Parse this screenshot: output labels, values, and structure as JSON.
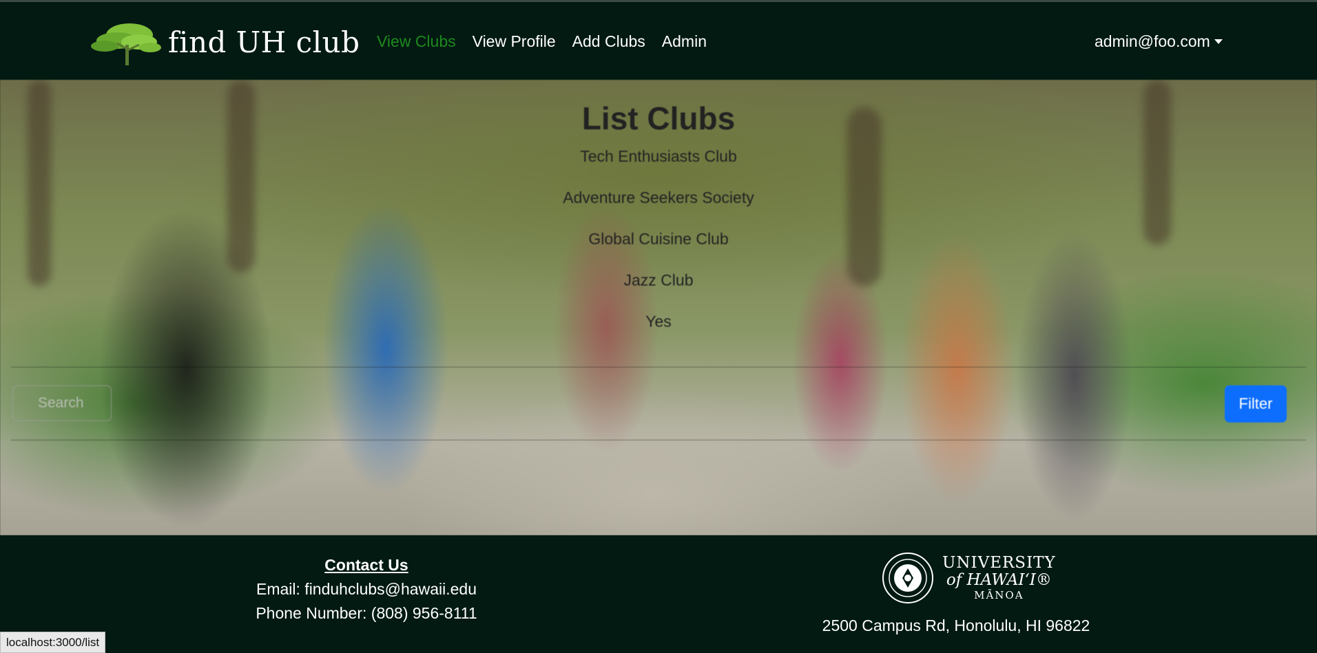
{
  "navbar": {
    "brand_text": "find UH club",
    "links": [
      {
        "label": "View Clubs",
        "active": true
      },
      {
        "label": "View Profile",
        "active": false
      },
      {
        "label": "Add Clubs",
        "active": false
      },
      {
        "label": "Admin",
        "active": false
      }
    ],
    "user_menu_label": "admin@foo.com",
    "icons": {
      "brand_logo": "tree-logo-icon",
      "user_menu": "caret-down-icon"
    },
    "colors": {
      "background": "#021a12",
      "active_link": "#1e8a1e"
    }
  },
  "main": {
    "title": "List Clubs",
    "clubs": [
      "Tech Enthusiasts Club",
      "Adventure Seekers Society",
      "Global Cuisine Club",
      "Jazz Club",
      "Yes"
    ],
    "search_placeholder": "Search",
    "filter_label": "Filter",
    "colors": {
      "filter_button": "#0d6efd"
    }
  },
  "footer": {
    "contact_title": "Contact Us",
    "email_line": "Email: finduhclubs@hawaii.edu",
    "phone_line": "Phone Number: (808) 956-8111",
    "uh_logo": {
      "line1": "UNIVERSITY",
      "line2": "of HAWAI‘I®",
      "line3": "MĀNOA"
    },
    "address": "2500 Campus Rd, Honolulu, HI 96822",
    "icons": {
      "seal": "uh-seal-icon"
    }
  },
  "status_bar": {
    "url": "localhost:3000/list"
  }
}
